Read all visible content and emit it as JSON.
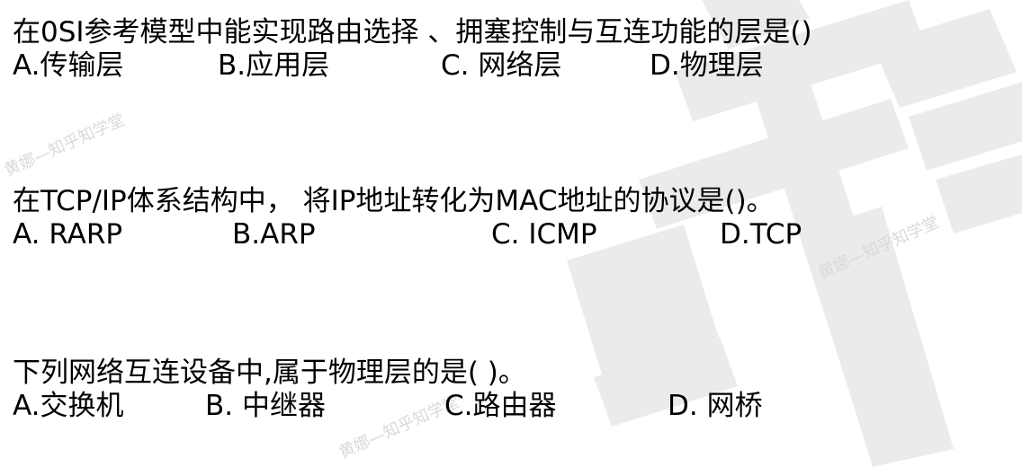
{
  "watermark": {
    "big_text": "知乎知学堂",
    "small_text": "黄娜—知乎知学堂",
    "color": "#dedede"
  },
  "questions": [
    {
      "stem": "在0SI参考模型中能实现路由选择 、拥塞控制与互连功能的层是()",
      "options": [
        "A.传输层",
        "B.应用层",
        "C. 网络层",
        "D.物理层"
      ]
    },
    {
      "stem": "在TCP/IP体系结构中， 将IP地址转化为MAC地址的协议是()。",
      "options": [
        "A.  RARP",
        "B.ARP",
        "C.  ICMP",
        "D.TCP"
      ]
    },
    {
      "stem": "下列网络互连设备中,属于物理层的是(    )。",
      "options": [
        "A.交换机",
        "B. 中继器",
        "C.路由器",
        "D. 网桥"
      ]
    }
  ]
}
